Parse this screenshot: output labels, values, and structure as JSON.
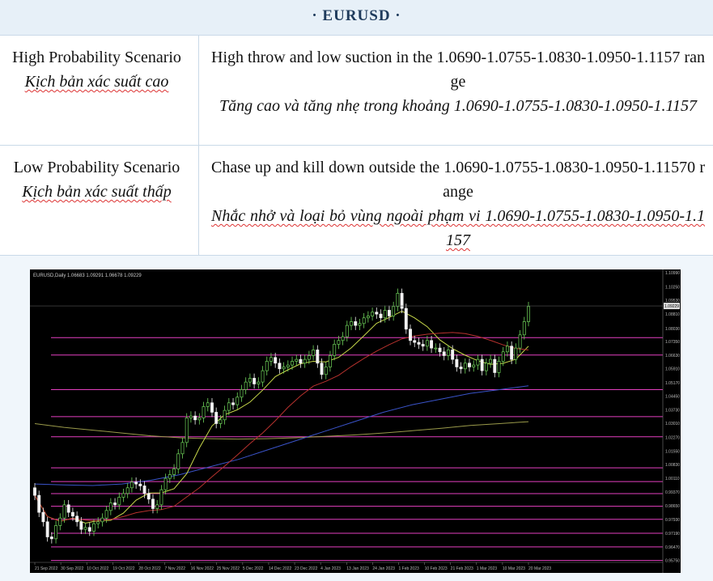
{
  "title": "· EURUSD ·",
  "scenarios": [
    {
      "label_en": "High Probability Scenario",
      "label_vn": "Kịch bản xác suất cao",
      "desc_en": "High throw and low suction in the 1.0690-1.0755-1.0830-1.0950-1.1157 range",
      "desc_vn": "Tăng cao và tăng nhẹ trong khoảng 1.0690-1.0755-1.0830-1.0950-1.1157"
    },
    {
      "label_en": "Low Probability Scenario",
      "label_vn": "Kịch bản xác suất thấp",
      "desc_en": "Chase up and kill down outside the 1.0690-1.0755-1.0830-1.0950-1.11570 range",
      "desc_vn": "Nhắc nhở và loại bỏ vùng ngoài phạm vi 1.0690-1.0755-1.0830-1.0950-1.1157"
    }
  ],
  "chart_data": {
    "type": "line",
    "title": "EURUSD,Daily  1.06683 1.09291 1.06678 1.09229",
    "ylim": [
      0.9565,
      1.1099
    ],
    "y_ticks": [
      "1.10990",
      "1.10250",
      "1.09530",
      "1.08810",
      "1.08030",
      "1.07350",
      "1.06630",
      "1.05910",
      "1.05170",
      "1.04450",
      "1.03730",
      "1.03010",
      "1.02270",
      "1.01550",
      "1.00830",
      "1.00110",
      "0.99370",
      "0.98650",
      "0.97930",
      "0.97190",
      "0.96470",
      "0.95750",
      "0.95030"
    ],
    "x_ticks": [
      "21 Sep 2022",
      "30 Sep 2022",
      "10 Oct 2022",
      "19 Oct 2022",
      "28 Oct 2022",
      "7 Nov 2022",
      "16 Nov 2022",
      "25 Nov 2022",
      "5 Dec 2022",
      "14 Dec 2022",
      "23 Dec 2022",
      "4 Jan 2023",
      "13 Jan 2023",
      "24 Jan 2023",
      "1 Feb 2023",
      "10 Feb 2023",
      "21 Feb 2023",
      "1 Mar 2023",
      "10 Mar 2023",
      "20 Mar 2023"
    ],
    "current_price": "1.09229",
    "levels": [
      1.0755,
      1.0663,
      1.048,
      1.0337,
      1.023,
      1.0066,
      0.9993,
      0.9929,
      0.9862,
      0.9793,
      0.9719,
      0.9647,
      0.9575
    ],
    "close": [
      0.992,
      0.983,
      0.978,
      0.97,
      0.969,
      0.976,
      0.98,
      0.987,
      0.983,
      0.981,
      0.978,
      0.974,
      0.975,
      0.973,
      0.977,
      0.978,
      0.98,
      0.984,
      0.988,
      0.987,
      0.991,
      0.993,
      0.996,
      0.999,
      0.998,
      0.997,
      0.993,
      0.99,
      0.985,
      0.987,
      0.995,
      1.001,
      1.003,
      1.006,
      1.014,
      1.02,
      1.033,
      1.034,
      1.032,
      1.033,
      1.039,
      1.041,
      1.036,
      1.03,
      1.032,
      1.037,
      1.041,
      1.04,
      1.044,
      1.048,
      1.052,
      1.054,
      1.051,
      1.052,
      1.058,
      1.063,
      1.065,
      1.062,
      1.059,
      1.06,
      1.061,
      1.063,
      1.064,
      1.062,
      1.064,
      1.066,
      1.069,
      1.062,
      1.056,
      1.06,
      1.066,
      1.072,
      1.074,
      1.076,
      1.082,
      1.084,
      1.082,
      1.083,
      1.086,
      1.087,
      1.089,
      1.088,
      1.086,
      1.09,
      1.087,
      1.092,
      1.099,
      1.091,
      1.08,
      1.074,
      1.073,
      1.072,
      1.071,
      1.074,
      1.07,
      1.07,
      1.068,
      1.066,
      1.069,
      1.064,
      1.06,
      1.059,
      1.062,
      1.06,
      1.061,
      1.064,
      1.058,
      1.062,
      1.064,
      1.057,
      1.063,
      1.068,
      1.071,
      1.064,
      1.07,
      1.077,
      1.084,
      1.092
    ],
    "ma_slow": [
      1.03,
      1.028,
      1.0265,
      1.025,
      1.0235,
      1.0225,
      1.022,
      1.0218,
      1.022,
      1.0225,
      1.0232,
      1.024,
      1.025,
      1.0262,
      1.0275,
      1.029,
      1.03,
      1.031
    ],
    "ma_mid": [
      0.998,
      0.9975,
      0.9972,
      0.998,
      1.0,
      1.003,
      1.007,
      1.011,
      1.016,
      1.021,
      1.026,
      1.031,
      1.036,
      1.04,
      1.043,
      1.046,
      1.048,
      1.05
    ]
  }
}
